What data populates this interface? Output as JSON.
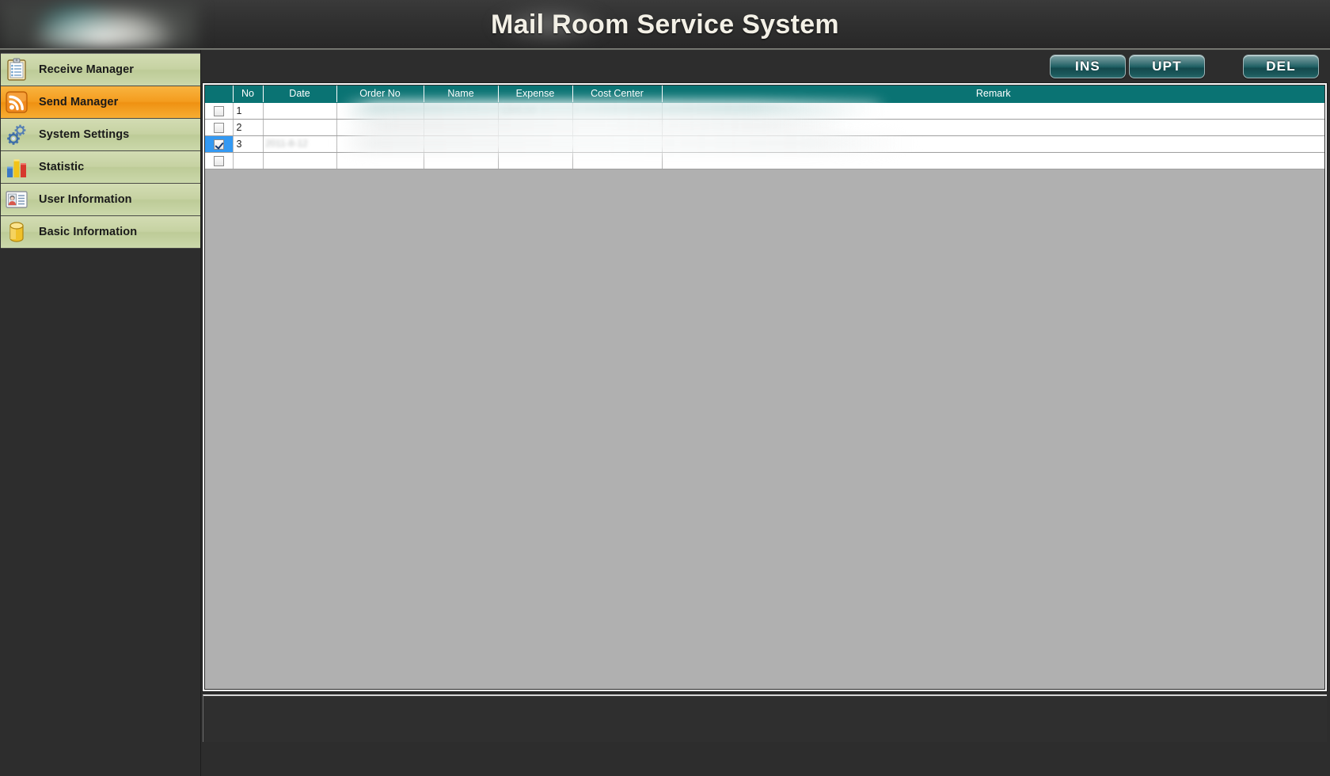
{
  "app": {
    "title": "Mail Room Service System",
    "logo_alt": "company-logo"
  },
  "sidebar": {
    "items": [
      {
        "label": "Receive Manager",
        "icon": "clipboard-icon",
        "active": false
      },
      {
        "label": "Send Manager",
        "icon": "rss-feed-icon",
        "active": true
      },
      {
        "label": "System Settings",
        "icon": "gears-icon",
        "active": false
      },
      {
        "label": "Statistic",
        "icon": "bar-chart-icon",
        "active": false
      },
      {
        "label": "User Information",
        "icon": "id-card-icon",
        "active": false
      },
      {
        "label": "Basic Information",
        "icon": "database-icon",
        "active": false
      }
    ]
  },
  "toolbar": {
    "insert_label": "INS",
    "update_label": "UPT",
    "delete_label": "DEL"
  },
  "grid": {
    "columns": [
      "",
      "No",
      "Date",
      "Order No",
      "Name",
      "Expense",
      "Cost Center",
      "Remark"
    ],
    "rows": [
      {
        "checked": false,
        "no": "1",
        "date": "",
        "order_no": "",
        "name": "",
        "expense": "",
        "cost_center": "",
        "remark": "",
        "selected": false
      },
      {
        "checked": false,
        "no": "2",
        "date": "",
        "order_no": "",
        "name": "",
        "expense": "",
        "cost_center": "",
        "remark": "",
        "selected": false
      },
      {
        "checked": true,
        "no": "3",
        "date": "",
        "order_no": "",
        "name": "",
        "expense": "",
        "cost_center": "",
        "remark": "",
        "selected": true
      },
      {
        "checked": false,
        "no": "",
        "date": "",
        "order_no": "",
        "name": "",
        "expense": "",
        "cost_center": "",
        "remark": "",
        "selected": false
      }
    ],
    "redacted_hints": {
      "row3_date": "2011-8-12",
      "row1_expense": "1345.00"
    }
  },
  "colors": {
    "header_teal": "#0a7373",
    "accent_orange": "#f49c1e",
    "nav_green": "#c6d2a2",
    "selection_blue": "#3399f3",
    "panel_gray": "#b0b0b0",
    "chrome_dark": "#2d2d2d"
  }
}
